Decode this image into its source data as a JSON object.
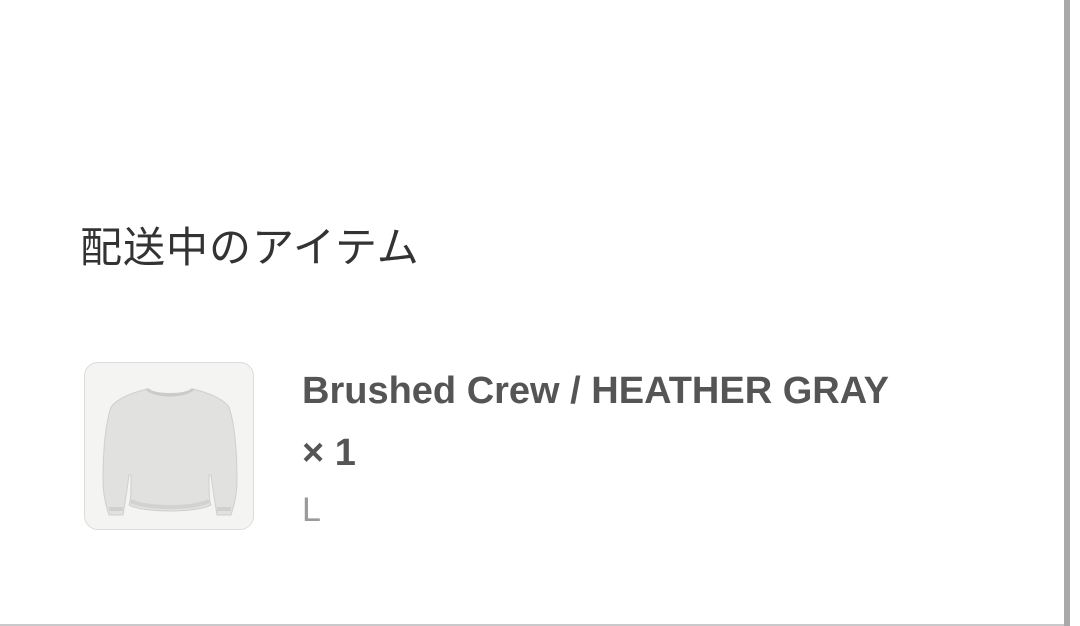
{
  "section": {
    "title": "配送中のアイテム"
  },
  "item": {
    "name": "Brushed Crew / HEATHER GRAY × 1",
    "variant": "L",
    "thumbnail_icon": "sweatshirt-icon",
    "thumbnail_color": "#e1e1e0"
  }
}
